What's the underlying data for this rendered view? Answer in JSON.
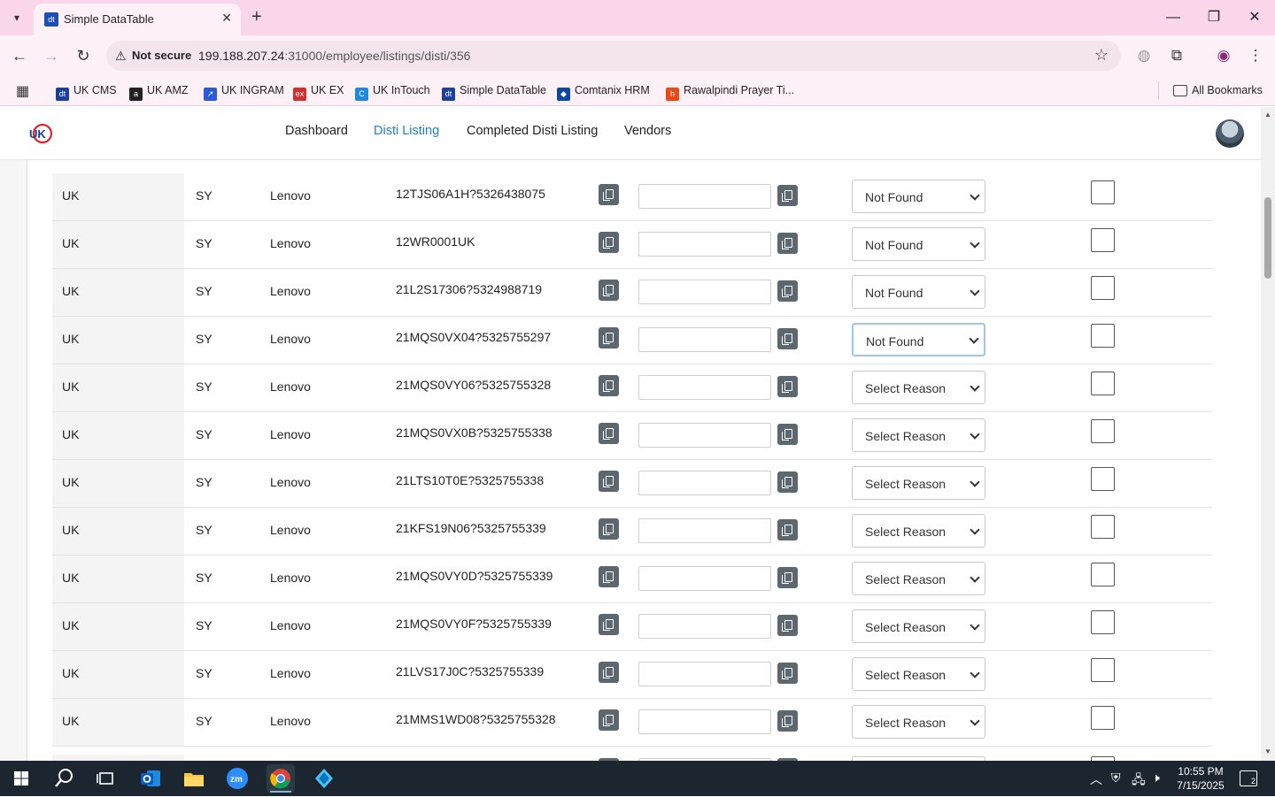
{
  "browser": {
    "tab_title": "Simple DataTable",
    "tab_favicon_text": "dt",
    "not_secure_label": "Not secure",
    "url_host": "199.188.207.24",
    "url_path": ":31000/employee/listings/disti/356",
    "bookmarks": [
      {
        "label": "UK CMS",
        "icon": "dt-icon",
        "color": "#1a3f9c",
        "glyph": "dt"
      },
      {
        "label": "UK AMZ",
        "icon": "amazon-icon",
        "color": "#222222",
        "glyph": "a"
      },
      {
        "label": "UK INGRAM",
        "icon": "ingram-icon",
        "color": "#2a5bd7",
        "glyph": "↗"
      },
      {
        "label": "UK EX",
        "icon": "ex-icon",
        "color": "#d32f2f",
        "glyph": "ex"
      },
      {
        "label": "UK InTouch",
        "icon": "intouch-icon",
        "color": "#1e88e5",
        "glyph": "C"
      },
      {
        "label": "Simple DataTable",
        "icon": "dt-icon",
        "color": "#1a3f9c",
        "glyph": "dt"
      },
      {
        "label": "Comtanix HRM",
        "icon": "hrm-icon",
        "color": "#0d47a1",
        "glyph": "◆"
      },
      {
        "label": "Rawalpindi Prayer Ti...",
        "icon": "prayer-icon",
        "color": "#e64a19",
        "glyph": "h"
      }
    ],
    "all_bookmarks_label": "All Bookmarks"
  },
  "appnav": {
    "logo_text": "UK",
    "links": [
      {
        "label": "Dashboard",
        "active": false
      },
      {
        "label": "Disti Listing",
        "active": true
      },
      {
        "label": "Completed Disti Listing",
        "active": false
      },
      {
        "label": "Vendors",
        "active": false
      }
    ]
  },
  "table": {
    "rows": [
      {
        "country": "UK",
        "code": "SY",
        "brand": "Lenovo",
        "sku": "12TJS06A1H?5326438075",
        "input": "",
        "reason": "Not Found",
        "focused": false,
        "checked": false
      },
      {
        "country": "UK",
        "code": "SY",
        "brand": "Lenovo",
        "sku": "12WR0001UK",
        "input": "",
        "reason": "Not Found",
        "focused": false,
        "checked": false
      },
      {
        "country": "UK",
        "code": "SY",
        "brand": "Lenovo",
        "sku": "21L2S17306?5324988719",
        "input": "",
        "reason": "Not Found",
        "focused": false,
        "checked": false
      },
      {
        "country": "UK",
        "code": "SY",
        "brand": "Lenovo",
        "sku": "21MQS0VX04?5325755297",
        "input": "",
        "reason": "Not Found",
        "focused": true,
        "checked": false
      },
      {
        "country": "UK",
        "code": "SY",
        "brand": "Lenovo",
        "sku": "21MQS0VY06?5325755328",
        "input": "",
        "reason": "Select Reason",
        "focused": false,
        "checked": false
      },
      {
        "country": "UK",
        "code": "SY",
        "brand": "Lenovo",
        "sku": "21MQS0VX0B?5325755338",
        "input": "",
        "reason": "Select Reason",
        "focused": false,
        "checked": false
      },
      {
        "country": "UK",
        "code": "SY",
        "brand": "Lenovo",
        "sku": "21LTS10T0E?5325755338",
        "input": "",
        "reason": "Select Reason",
        "focused": false,
        "checked": false
      },
      {
        "country": "UK",
        "code": "SY",
        "brand": "Lenovo",
        "sku": "21KFS19N06?5325755339",
        "input": "",
        "reason": "Select Reason",
        "focused": false,
        "checked": false
      },
      {
        "country": "UK",
        "code": "SY",
        "brand": "Lenovo",
        "sku": "21MQS0VY0D?5325755339",
        "input": "",
        "reason": "Select Reason",
        "focused": false,
        "checked": false
      },
      {
        "country": "UK",
        "code": "SY",
        "brand": "Lenovo",
        "sku": "21MQS0VY0F?5325755339",
        "input": "",
        "reason": "Select Reason",
        "focused": false,
        "checked": false
      },
      {
        "country": "UK",
        "code": "SY",
        "brand": "Lenovo",
        "sku": "21LVS17J0C?5325755339",
        "input": "",
        "reason": "Select Reason",
        "focused": false,
        "checked": false
      },
      {
        "country": "UK",
        "code": "SY",
        "brand": "Lenovo",
        "sku": "21MMS1WD08?5325755328",
        "input": "",
        "reason": "Select Reason",
        "focused": false,
        "checked": false
      }
    ]
  },
  "taskbar": {
    "time": "10:55 PM",
    "date": "7/15/2025",
    "notification_count": "2",
    "apps": [
      {
        "name": "windows-start-icon"
      },
      {
        "name": "search-icon"
      },
      {
        "name": "task-view-icon"
      },
      {
        "name": "outlook-icon"
      },
      {
        "name": "file-explorer-icon"
      },
      {
        "name": "zoom-icon",
        "glyph": "zm"
      },
      {
        "name": "chrome-icon"
      },
      {
        "name": "app-diamond-icon"
      }
    ]
  },
  "colors": {
    "accent": "#1e7fc8",
    "tabbar": "#f9d6ea",
    "toolbar": "#fdf0f7",
    "copy_button": "#5c6770",
    "taskbar": "#1c2630"
  }
}
